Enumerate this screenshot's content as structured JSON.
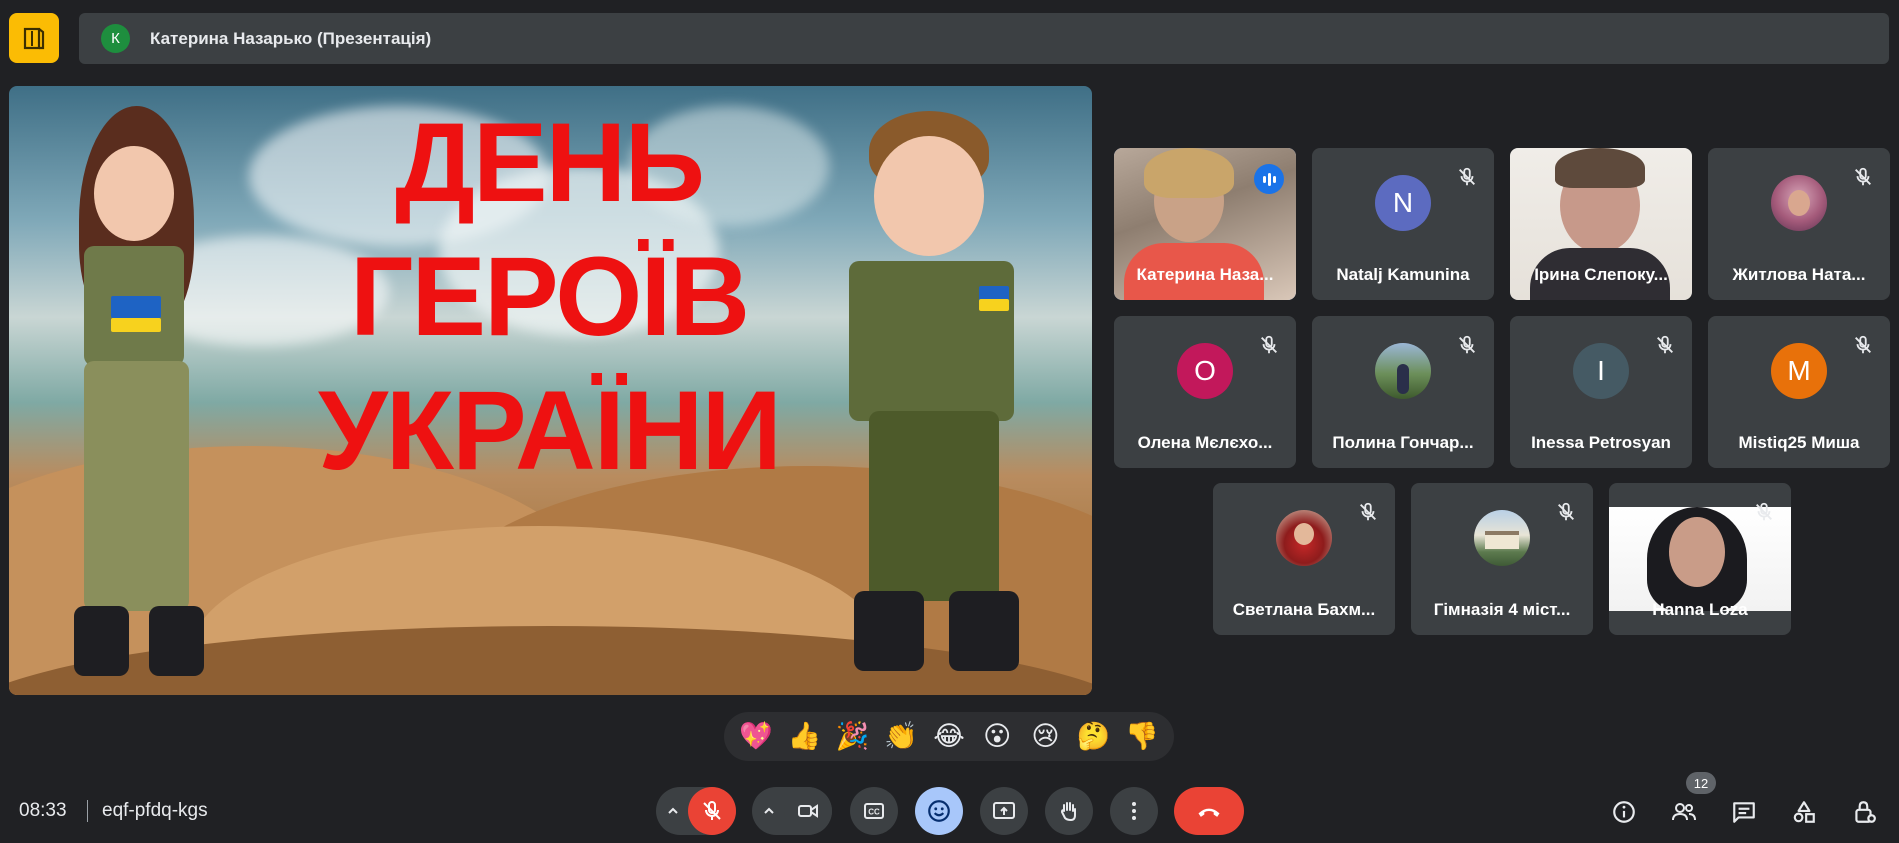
{
  "top_bar": {
    "avatar_letter": "К",
    "title": "Катерина Назарько (Презентація)"
  },
  "slide": {
    "lines": [
      "ДЕНЬ",
      "ГЕРОЇВ",
      "УКРАЇНИ"
    ],
    "title_color": "#ee1111"
  },
  "participants": [
    {
      "name": "Катерина Наза...",
      "video": true,
      "speaking": true
    },
    {
      "name": "Natalj Kamunina",
      "letter": "N",
      "color": "#5c6bc0",
      "muted": true
    },
    {
      "name": "Ірина Слепоку...",
      "video": true
    },
    {
      "name": "Житлова Ната...",
      "photo": true,
      "muted": true
    },
    {
      "name": "Олена Мєлєхо...",
      "letter": "О",
      "color": "#c2185b",
      "muted": true
    },
    {
      "name": "Полина Гончар...",
      "photo": true,
      "muted": true
    },
    {
      "name": "Inessa Petrosyan",
      "letter": "I",
      "color": "#455a64",
      "muted": true
    },
    {
      "name": "Mistiq25 Миша",
      "letter": "M",
      "color": "#e8710a",
      "muted": true
    },
    {
      "name": "Светлана Бахм...",
      "photo": true,
      "muted": true
    },
    {
      "name": "Гімназія 4 міст...",
      "photo": true,
      "muted": true
    },
    {
      "name": "Hanna Loza",
      "video": true,
      "muted": true
    }
  ],
  "reactions": [
    "💖",
    "👍",
    "🎉",
    "👏",
    "😂",
    "😮",
    "😢",
    "🤔",
    "👎"
  ],
  "bottom_bar": {
    "time": "08:33",
    "meeting_code": "eqf-pfdq-kgs",
    "participants_count": "12"
  },
  "colors": {
    "background": "#202124",
    "tile": "#3c4043",
    "accent": "#8ab4f8",
    "danger": "#ea4335"
  }
}
